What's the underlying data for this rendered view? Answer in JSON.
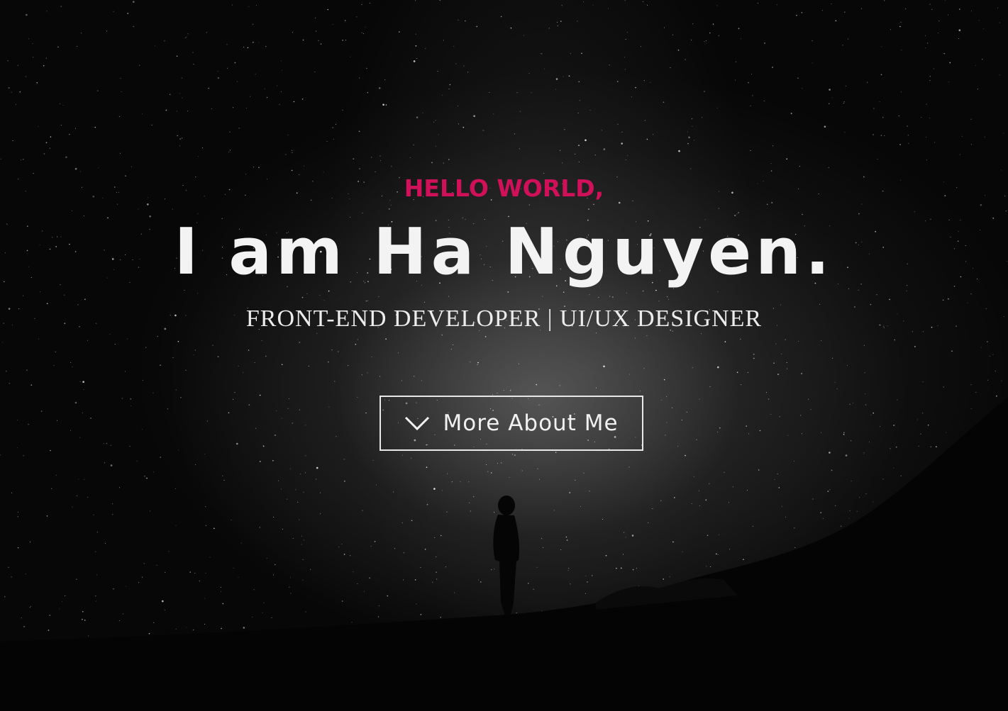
{
  "hero": {
    "greeting": "HELLO WORLD,",
    "name": "I am Ha Nguyen.",
    "role": "FRONT-END DEVELOPER | UI/UX DESIGNER",
    "cta_label": "More About Me",
    "cta_icon": "chevron-down-icon"
  },
  "colors": {
    "accent": "#d1105a",
    "text": "#f3f3f3",
    "background": "#050505"
  }
}
